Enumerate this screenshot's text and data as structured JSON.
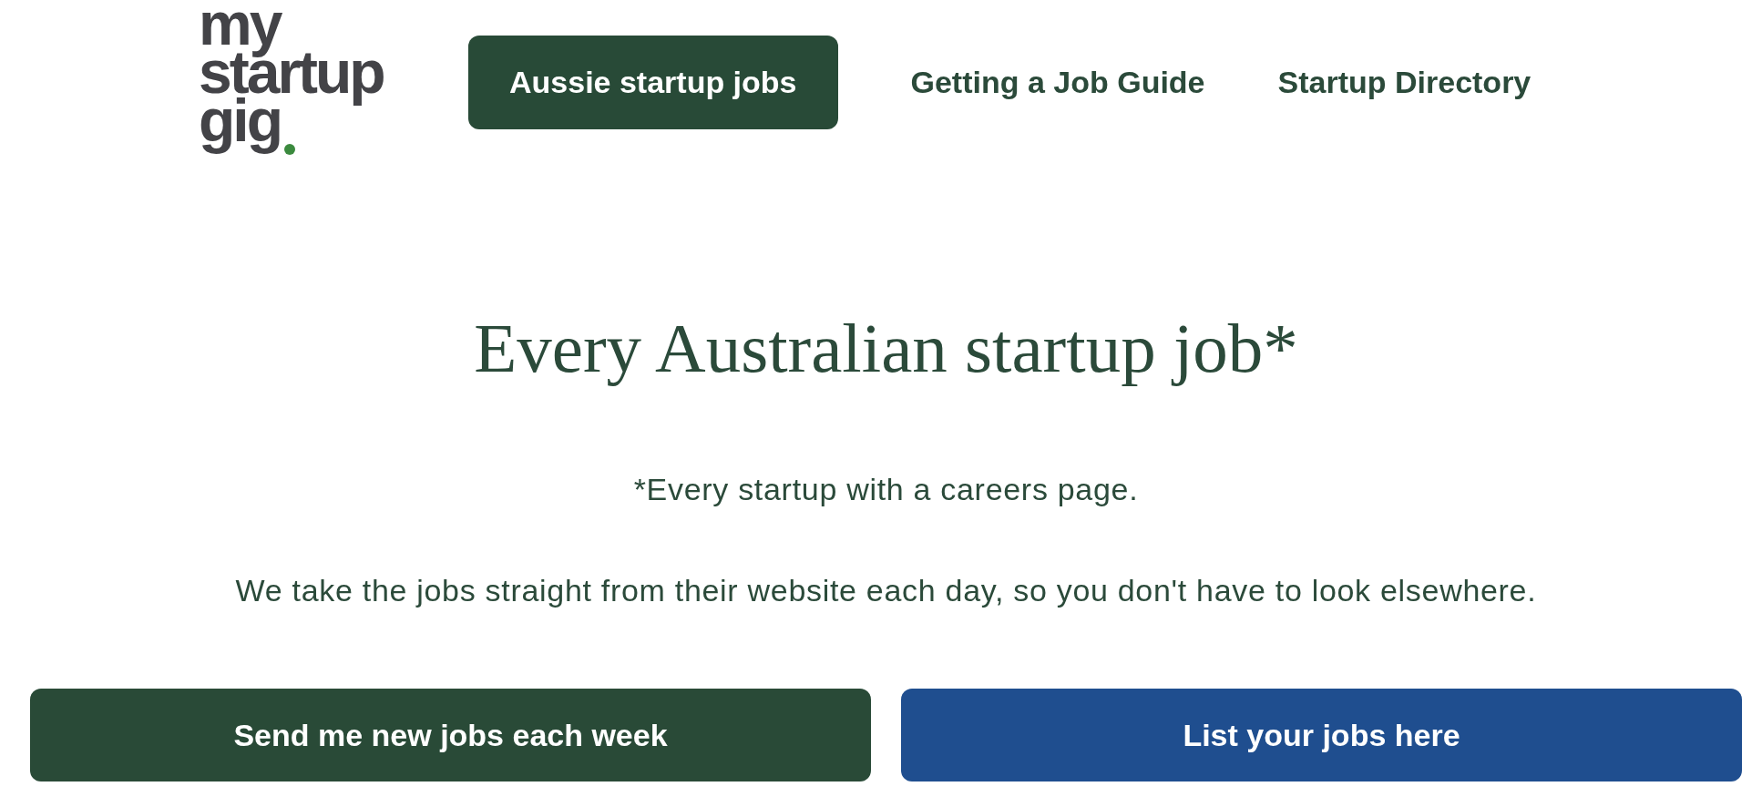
{
  "header": {
    "logo": {
      "lines": [
        "my",
        "startup",
        "gig"
      ]
    },
    "nav": [
      {
        "label": "Aussie startup jobs",
        "selected": true
      },
      {
        "label": "Getting a Job Guide",
        "selected": false
      },
      {
        "label": "Startup Directory",
        "selected": false
      }
    ]
  },
  "hero": {
    "title": "Every Australian startup job*",
    "footnote": "*Every startup with a careers page.",
    "description": "We take the jobs straight from their website each day, so you don't have to look elsewhere."
  },
  "actions": [
    {
      "label": "Send me new jobs each week",
      "color": "#294a37"
    },
    {
      "label": "List your jobs here",
      "color": "#1f4e8f"
    }
  ]
}
